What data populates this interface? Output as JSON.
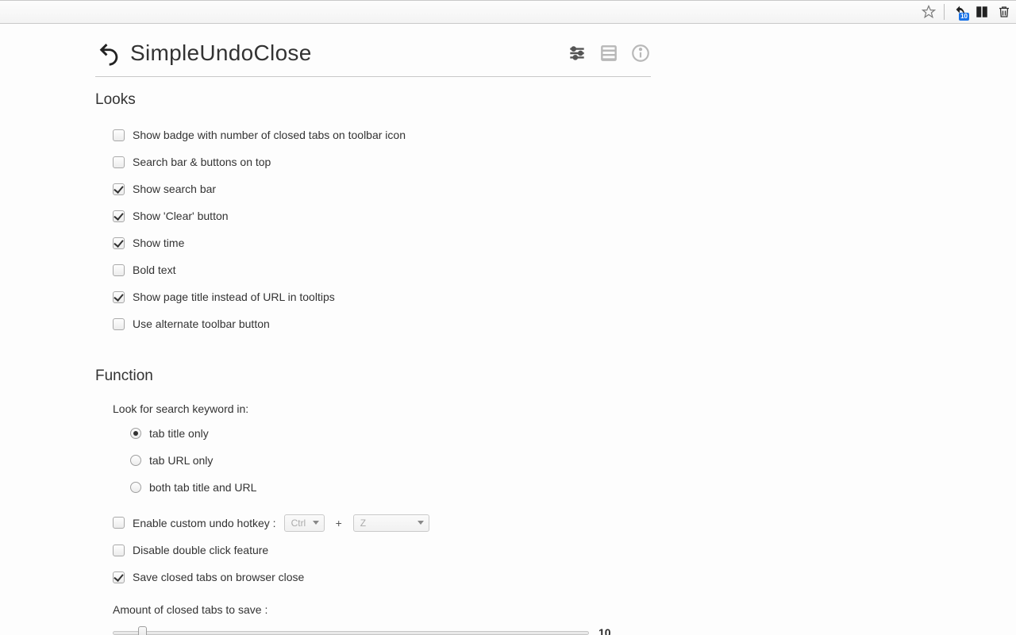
{
  "chrome": {
    "undo_badge": "10"
  },
  "header": {
    "title": "SimpleUndoClose"
  },
  "sections": {
    "looks": {
      "title": "Looks",
      "options": [
        {
          "label": "Show badge with number of closed tabs on toolbar icon",
          "checked": false
        },
        {
          "label": "Search bar & buttons on top",
          "checked": false
        },
        {
          "label": "Show search bar",
          "checked": true
        },
        {
          "label": "Show 'Clear' button",
          "checked": true
        },
        {
          "label": "Show time",
          "checked": true
        },
        {
          "label": "Bold text",
          "checked": false
        },
        {
          "label": "Show page title instead of URL in tooltips",
          "checked": true
        },
        {
          "label": "Use alternate toolbar button",
          "checked": false
        }
      ]
    },
    "function": {
      "title": "Function",
      "search_keyword_label": "Look for search keyword in:",
      "radios": [
        {
          "label": "tab title only",
          "checked": true
        },
        {
          "label": "tab URL only",
          "checked": false
        },
        {
          "label": "both tab title and URL",
          "checked": false
        }
      ],
      "hotkey": {
        "label": "Enable custom undo hotkey :",
        "checked": false,
        "mod": "Ctrl",
        "plus": "+",
        "key": "Z"
      },
      "disable_dblclick": {
        "label": "Disable double click feature",
        "checked": false
      },
      "save_on_close": {
        "label": "Save closed tabs on browser close",
        "checked": true
      },
      "amount_label": "Amount of closed tabs to save :",
      "amount_value": "10"
    }
  }
}
